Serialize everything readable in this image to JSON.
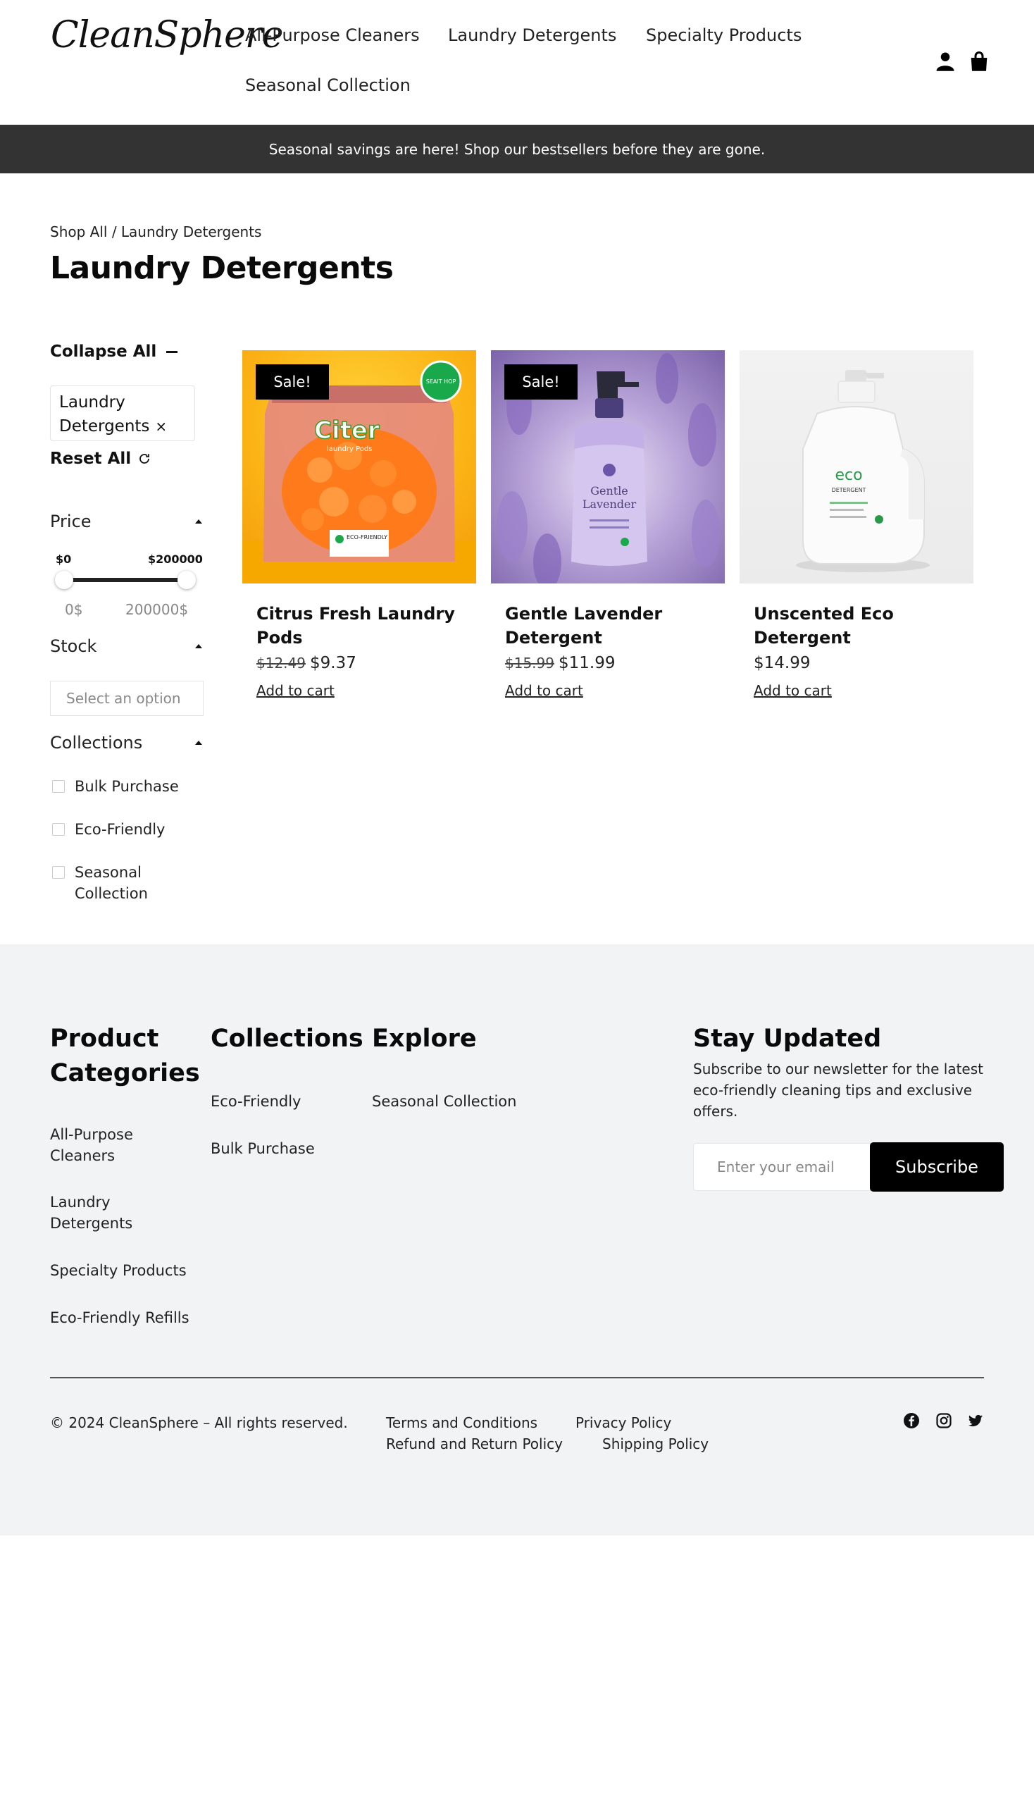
{
  "header": {
    "logo": "CleanSphere",
    "nav": [
      "All-Purpose Cleaners",
      "Laundry Detergents",
      "Specialty Products",
      "Seasonal Collection"
    ],
    "icons": [
      "account-icon",
      "cart-icon"
    ]
  },
  "announcement": "Seasonal savings are here! Shop our bestsellers before they are gone.",
  "breadcrumb": "Shop All / Laundry Detergents",
  "page_title": "Laundry Detergents",
  "sidebar": {
    "collapse_all": "Collapse All",
    "active_filter": "Laundry Detergents",
    "active_filter_remove": "×",
    "reset_all": "Reset All",
    "price": {
      "title": "Price",
      "min_label": "$0",
      "max_label": "$200000",
      "min_value": "0$",
      "max_value": "200000$"
    },
    "stock": {
      "title": "Stock",
      "placeholder": "Select an option"
    },
    "collections": {
      "title": "Collections",
      "options": [
        "Bulk Purchase",
        "Eco-Friendly",
        "Seasonal Collection"
      ]
    }
  },
  "products": [
    {
      "title": "Citrus Fresh Laundry Pods",
      "old_price": "$12.49",
      "price": "$9.37",
      "sale": "Sale!",
      "cta": "Add to cart",
      "image_text": {
        "brand": "Citer",
        "sub": "laundry Pods",
        "seal": "SEAIT HOP",
        "label": "ECO-FRIENDLY"
      }
    },
    {
      "title": "Gentle Lavender Detergent",
      "old_price": "$15.99",
      "price": "$11.99",
      "sale": "Sale!",
      "cta": "Add to cart",
      "image_text": {
        "brand": "Gentle",
        "sub": "Lavender"
      }
    },
    {
      "title": "Unscented Eco Detergent",
      "old_price": "",
      "price": "$14.99",
      "sale": "",
      "cta": "Add to cart",
      "image_text": {
        "brand": "eco",
        "sub": "DETERGENT"
      }
    }
  ],
  "footer": {
    "product_categories": {
      "title": "Product Categories",
      "links": [
        "All-Purpose Cleaners",
        "Laundry Detergents",
        "Specialty Products",
        "Eco-Friendly Refills"
      ]
    },
    "collections": {
      "title": "Collections",
      "links": [
        "Eco-Friendly",
        "Bulk Purchase"
      ]
    },
    "explore": {
      "title": "Explore",
      "links": [
        "Seasonal Collection"
      ]
    },
    "newsletter": {
      "title": "Stay Updated",
      "blurb": "Subscribe to our newsletter for the latest eco-friendly cleaning tips and exclusive offers.",
      "placeholder": "Enter your email",
      "button": "Subscribe"
    },
    "copyright": "© 2024 CleanSphere – All rights reserved.",
    "legal": [
      "Terms and Conditions",
      "Privacy Policy",
      "Refund and Return Policy",
      "Shipping Policy"
    ],
    "social": [
      "facebook-icon",
      "instagram-icon",
      "twitter-icon"
    ]
  },
  "colors": {
    "announcement_bg": "#333333",
    "footer_bg": "#f2f3f5",
    "button_bg": "#000000",
    "seal_green": "#19a84a"
  }
}
